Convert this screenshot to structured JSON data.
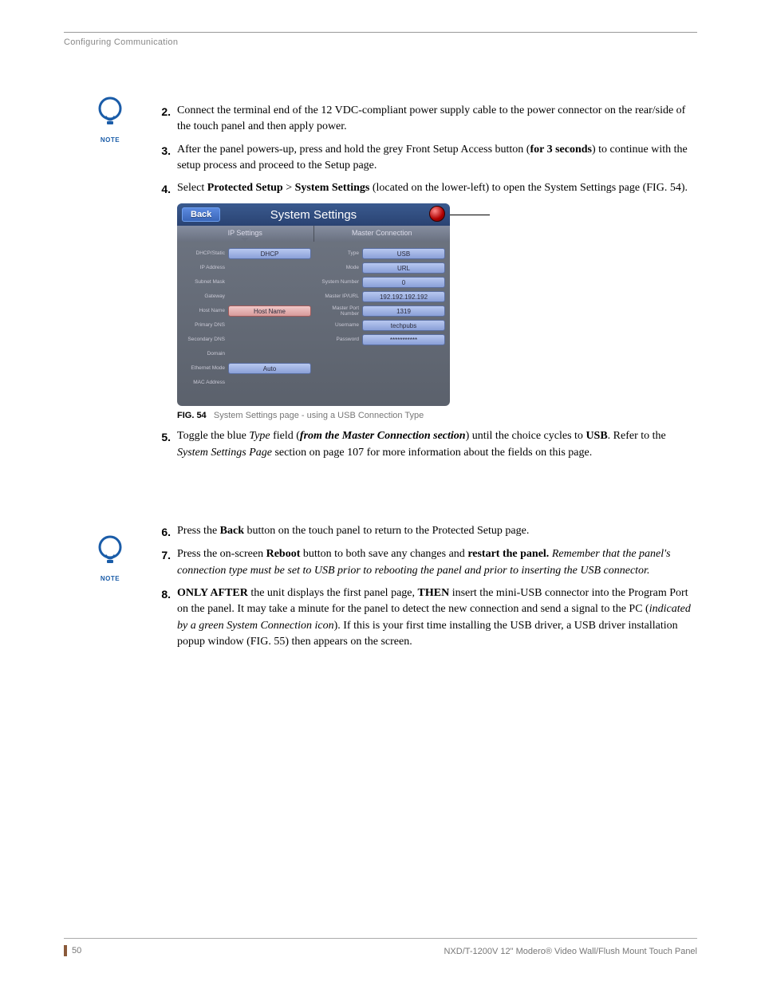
{
  "header": {
    "section": "Configuring Communication"
  },
  "note_label": "NOTE",
  "steps_a": [
    {
      "n": "2.",
      "html": "Connect the terminal end of the 12 VDC-compliant power supply cable to the power connector on the rear/side of the touch panel and then apply power."
    },
    {
      "n": "3.",
      "html": "After the panel powers-up, press and hold the grey Front Setup Access button (<b>for 3 seconds</b>) to continue with the setup process and proceed to the Setup page."
    },
    {
      "n": "4.",
      "html": "Select <b>Protected Setup</b> > <b>System Settings</b> (located on the lower-left) to open the System Settings page (FIG. 54)."
    }
  ],
  "panel": {
    "back": "Back",
    "title": "System Settings",
    "tabs": {
      "left": "IP Settings",
      "right": "Master Connection"
    },
    "ip_rows": [
      {
        "label": "DHCP/Static",
        "value": "DHCP",
        "style": "blue"
      },
      {
        "label": "IP Address",
        "value": "",
        "style": "empty"
      },
      {
        "label": "Subnet Mask",
        "value": "",
        "style": "empty"
      },
      {
        "label": "Gateway",
        "value": "",
        "style": "empty"
      },
      {
        "label": "Host Name",
        "value": "Host Name",
        "style": "pink"
      },
      {
        "label": "Primary DNS",
        "value": "",
        "style": "empty"
      },
      {
        "label": "Secondary DNS",
        "value": "",
        "style": "empty"
      },
      {
        "label": "Domain",
        "value": "",
        "style": "empty"
      },
      {
        "label": "Ethernet Mode",
        "value": "Auto",
        "style": "blue"
      },
      {
        "label": "MAC Address",
        "value": "",
        "style": "empty"
      }
    ],
    "mc_rows": [
      {
        "label": "Type",
        "value": "USB",
        "style": "blue"
      },
      {
        "label": "Mode",
        "value": "URL",
        "style": "blue"
      },
      {
        "label": "System Number",
        "value": "0",
        "style": "blue"
      },
      {
        "label": "Master IP/URL",
        "value": "192.192.192.192",
        "style": "blue"
      },
      {
        "label": "Master Port Number",
        "value": "1319",
        "style": "blue"
      },
      {
        "label": "Username",
        "value": "techpubs",
        "style": "blue"
      },
      {
        "label": "Password",
        "value": "***********",
        "style": "blue"
      }
    ]
  },
  "figure": {
    "num": "FIG. 54",
    "text": "System Settings page - using a USB Connection Type"
  },
  "steps_b": [
    {
      "n": "5.",
      "html": "Toggle the blue <i>Type</i> field (<i><b>from the Master Connection section</b></i>) until the choice cycles to <b>USB</b>. Refer to the <i>System Settings Page</i> section on page 107 for more information about the fields on this page."
    }
  ],
  "steps_c": [
    {
      "n": "6.",
      "html": "Press the <b>Back</b> button on the touch panel to return to the Protected Setup page."
    },
    {
      "n": "7.",
      "html": "Press the on-screen <b>Reboot</b> button to both save any changes and <b>restart the panel.</b> <i>Remember that the panel's connection type must be set to USB prior to rebooting the panel and prior to inserting the USB connector.</i>"
    },
    {
      "n": "8.",
      "html": "<b>ONLY AFTER</b> the unit displays the first panel page, <b>THEN</b> insert the mini-USB connector into the Program Port on the panel. It may take a minute for the panel to detect the new connection and send a signal to the PC (<i>indicated by a green System Connection icon</i>). If this is your first time installing the USB driver, a USB driver installation popup window (FIG. 55) then appears on the screen."
    }
  ],
  "footer": {
    "page": "50",
    "product": "NXD/T-1200V 12\" Modero® Video Wall/Flush Mount Touch Panel"
  }
}
